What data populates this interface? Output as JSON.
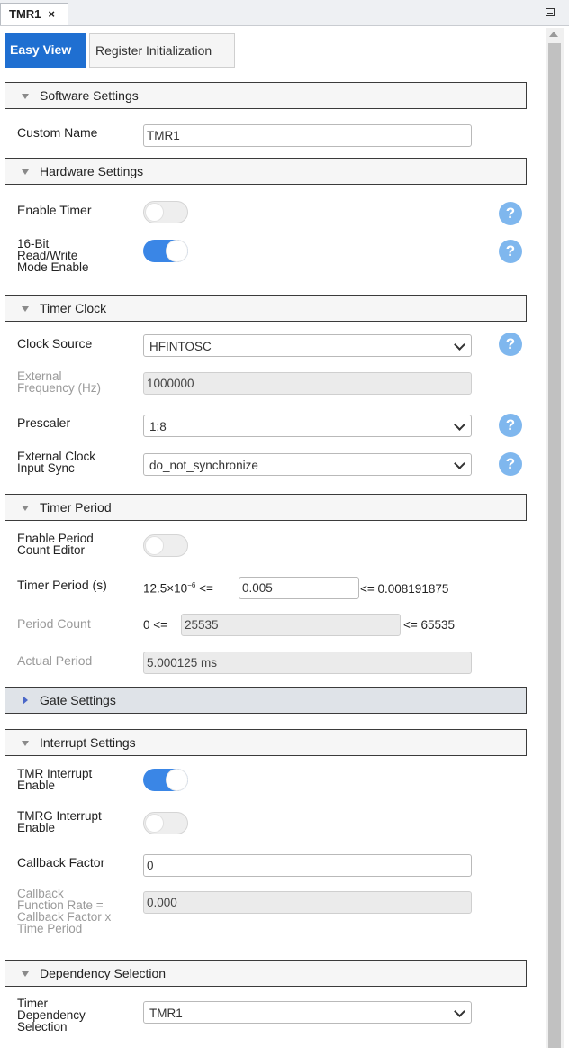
{
  "doc_tab": {
    "label": "TMR1",
    "close": "×"
  },
  "tabs": {
    "easy_view": "Easy View",
    "register_init": "Register Initialization"
  },
  "sections": {
    "software": "Software Settings",
    "hardware": "Hardware Settings",
    "timer_clock": "Timer Clock",
    "timer_period": "Timer Period",
    "gate": "Gate Settings",
    "interrupt": "Interrupt Settings",
    "dependency": "Dependency Selection"
  },
  "software": {
    "custom_name_label": "Custom Name",
    "custom_name_value": "TMR1"
  },
  "hardware": {
    "enable_timer_label": "Enable Timer",
    "enable_timer_on": false,
    "rw16_label_1": "16-Bit",
    "rw16_label_2": "Read/Write",
    "rw16_label_3": "Mode Enable",
    "rw16_on": true
  },
  "timer_clock": {
    "clock_source_label": "Clock Source",
    "clock_source_value": "HFINTOSC",
    "ext_freq_label_1": "External",
    "ext_freq_label_2": "Frequency (Hz)",
    "ext_freq_value": "1000000",
    "prescaler_label": "Prescaler",
    "prescaler_value": "1:8",
    "ext_sync_label_1": "External Clock",
    "ext_sync_label_2": "Input Sync",
    "ext_sync_value": "do_not_synchronize"
  },
  "timer_period": {
    "enable_editor_label_1": "Enable Period",
    "enable_editor_label_2": "Count Editor",
    "enable_editor_on": false,
    "period_label": "Timer Period (s)",
    "period_min_base": "12.5×10",
    "period_min_exp": "−6",
    "period_min_op": " <=",
    "period_value": "0.005",
    "period_max": "<= 0.008191875",
    "count_label": "Period Count",
    "count_min": "0 <=",
    "count_value": "25535",
    "count_max": "<= 65535",
    "actual_label": "Actual Period",
    "actual_value": "5.000125 ms"
  },
  "interrupt": {
    "tmr_int_label_1": "TMR Interrupt",
    "tmr_int_label_2": "Enable",
    "tmr_int_on": true,
    "tmrg_int_label_1": "TMRG Interrupt",
    "tmrg_int_label_2": "Enable",
    "tmrg_int_on": false,
    "cb_factor_label": "Callback Factor",
    "cb_factor_value": "0",
    "cb_rate_label_1": "Callback",
    "cb_rate_label_2": "Function Rate =",
    "cb_rate_label_3": "Callback Factor x",
    "cb_rate_label_4": "Time Period",
    "cb_rate_value": "0.000"
  },
  "dependency": {
    "label_1": "Timer",
    "label_2": "Dependency",
    "label_3": "Selection",
    "value": "TMR1"
  },
  "help_glyph": "?",
  "colors": {
    "accent": "#1f6fd1",
    "toggle_on": "#3a86e6",
    "help": "#7fb7ee"
  }
}
